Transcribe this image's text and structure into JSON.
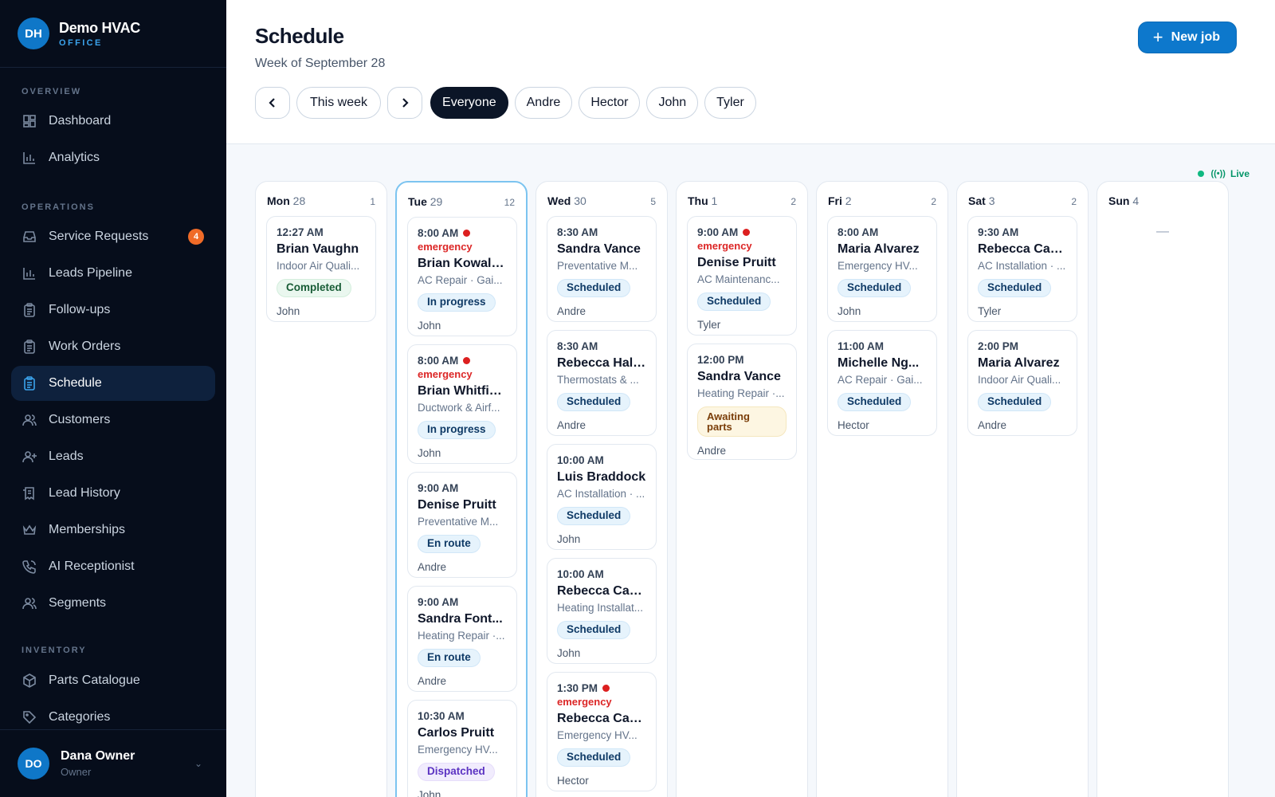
{
  "brand": {
    "initials": "DH",
    "name": "Demo HVAC",
    "sub": "OFFICE"
  },
  "sidebar": {
    "sections": [
      {
        "title": "OVERVIEW"
      },
      {
        "title": "OPERATIONS"
      },
      {
        "title": "INVENTORY"
      }
    ],
    "items": [
      {
        "label": "Dashboard",
        "icon": "dashboard-icon"
      },
      {
        "label": "Analytics",
        "icon": "bar-chart-icon"
      },
      {
        "label": "Service Requests",
        "icon": "inbox-icon",
        "badge": "4"
      },
      {
        "label": "Leads Pipeline",
        "icon": "bar-chart-icon"
      },
      {
        "label": "Follow-ups",
        "icon": "clipboard-icon"
      },
      {
        "label": "Work Orders",
        "icon": "clipboard-icon"
      },
      {
        "label": "Schedule",
        "icon": "clipboard-icon",
        "active": true
      },
      {
        "label": "Customers",
        "icon": "users-icon"
      },
      {
        "label": "Leads",
        "icon": "user-plus-icon"
      },
      {
        "label": "Lead History",
        "icon": "receipt-icon"
      },
      {
        "label": "Memberships",
        "icon": "crown-icon"
      },
      {
        "label": "AI Receptionist",
        "icon": "phone-icon"
      },
      {
        "label": "Segments",
        "icon": "users-icon"
      },
      {
        "label": "Parts Catalogue",
        "icon": "box-icon"
      },
      {
        "label": "Categories",
        "icon": "tag-icon"
      }
    ]
  },
  "user": {
    "initials": "DO",
    "name": "Dana Owner",
    "role": "Owner"
  },
  "header": {
    "title": "Schedule",
    "subtitle": "Week of September 28",
    "new_job": "New job",
    "this_week": "This week",
    "filters": [
      "Everyone",
      "Andre",
      "Hector",
      "John",
      "Tyler"
    ],
    "selected_filter": "Everyone"
  },
  "live_label": "Live",
  "colors": {
    "accent": "#0d78cc",
    "sidebar": "#060d1b",
    "emergency": "#dc2626"
  },
  "days": [
    {
      "day": "Mon",
      "date": "28",
      "count": "1",
      "jobs": [
        {
          "time": "12:27 AM",
          "name": "Brian Vaughn",
          "type": "Indoor Air Quali...",
          "status": "Completed",
          "kind": "completed",
          "tech": "John"
        }
      ]
    },
    {
      "day": "Tue",
      "date": "29",
      "count": "12",
      "today": true,
      "jobs": [
        {
          "time": "8:00 AM",
          "emergency": "emergency",
          "name": "Brian Kowalski",
          "type": "AC Repair · Gai...",
          "status": "In progress",
          "kind": "inprogress",
          "tech": "John"
        },
        {
          "time": "8:00 AM",
          "emergency": "emergency",
          "name": "Brian Whitfield",
          "type": "Ductwork & Airf...",
          "status": "In progress",
          "kind": "inprogress",
          "tech": "John"
        },
        {
          "time": "9:00 AM",
          "name": "Denise Pruitt",
          "type": "Preventative M...",
          "status": "En route",
          "kind": "enroute",
          "tech": "Andre"
        },
        {
          "time": "9:00 AM",
          "name": "Sandra Font...",
          "type": "Heating Repair ·...",
          "status": "En route",
          "kind": "enroute",
          "tech": "Andre"
        },
        {
          "time": "10:30 AM",
          "name": "Carlos Pruitt",
          "type": "Emergency HV...",
          "status": "Dispatched",
          "kind": "dispatched",
          "tech": "John"
        }
      ]
    },
    {
      "day": "Wed",
      "date": "30",
      "count": "5",
      "jobs": [
        {
          "time": "8:30 AM",
          "name": "Sandra Vance",
          "type": "Preventative M...",
          "status": "Scheduled",
          "kind": "scheduled",
          "tech": "Andre"
        },
        {
          "time": "8:30 AM",
          "name": "Rebecca Hall...",
          "type": "Thermostats & ...",
          "status": "Scheduled",
          "kind": "scheduled",
          "tech": "Andre"
        },
        {
          "time": "10:00 AM",
          "name": "Luis Braddock",
          "type": "AC Installation · ...",
          "status": "Scheduled",
          "kind": "scheduled",
          "tech": "John"
        },
        {
          "time": "10:00 AM",
          "name": "Rebecca Cas...",
          "type": "Heating Installat...",
          "status": "Scheduled",
          "kind": "scheduled",
          "tech": "John"
        },
        {
          "time": "1:30 PM",
          "emergency": "emergency",
          "name": "Rebecca Cas...",
          "type": "Emergency HV...",
          "status": "Scheduled",
          "kind": "scheduled",
          "tech": "Hector"
        }
      ]
    },
    {
      "day": "Thu",
      "date": "1",
      "count": "2",
      "jobs": [
        {
          "time": "9:00 AM",
          "emergency": "emergency",
          "name": "Denise Pruitt",
          "type": "AC Maintenanc...",
          "status": "Scheduled",
          "kind": "scheduled",
          "tech": "Tyler"
        },
        {
          "time": "12:00 PM",
          "name": "Sandra Vance",
          "type": "Heating Repair ·...",
          "status": "Awaiting parts",
          "kind": "awaiting",
          "tech": "Andre"
        }
      ]
    },
    {
      "day": "Fri",
      "date": "2",
      "count": "2",
      "jobs": [
        {
          "time": "8:00 AM",
          "name": "Maria Alvarez",
          "type": "Emergency HV...",
          "status": "Scheduled",
          "kind": "scheduled",
          "tech": "John"
        },
        {
          "time": "11:00 AM",
          "name": "Michelle Ng...",
          "type": "AC Repair · Gai...",
          "status": "Scheduled",
          "kind": "scheduled",
          "tech": "Hector"
        }
      ]
    },
    {
      "day": "Sat",
      "date": "3",
      "count": "2",
      "jobs": [
        {
          "time": "9:30 AM",
          "name": "Rebecca Cas...",
          "type": "AC Installation · ...",
          "status": "Scheduled",
          "kind": "scheduled",
          "tech": "Tyler"
        },
        {
          "time": "2:00 PM",
          "name": "Maria Alvarez",
          "type": "Indoor Air Quali...",
          "status": "Scheduled",
          "kind": "scheduled",
          "tech": "Andre"
        }
      ]
    },
    {
      "day": "Sun",
      "date": "4",
      "count": "",
      "empty": "—",
      "jobs": []
    }
  ]
}
